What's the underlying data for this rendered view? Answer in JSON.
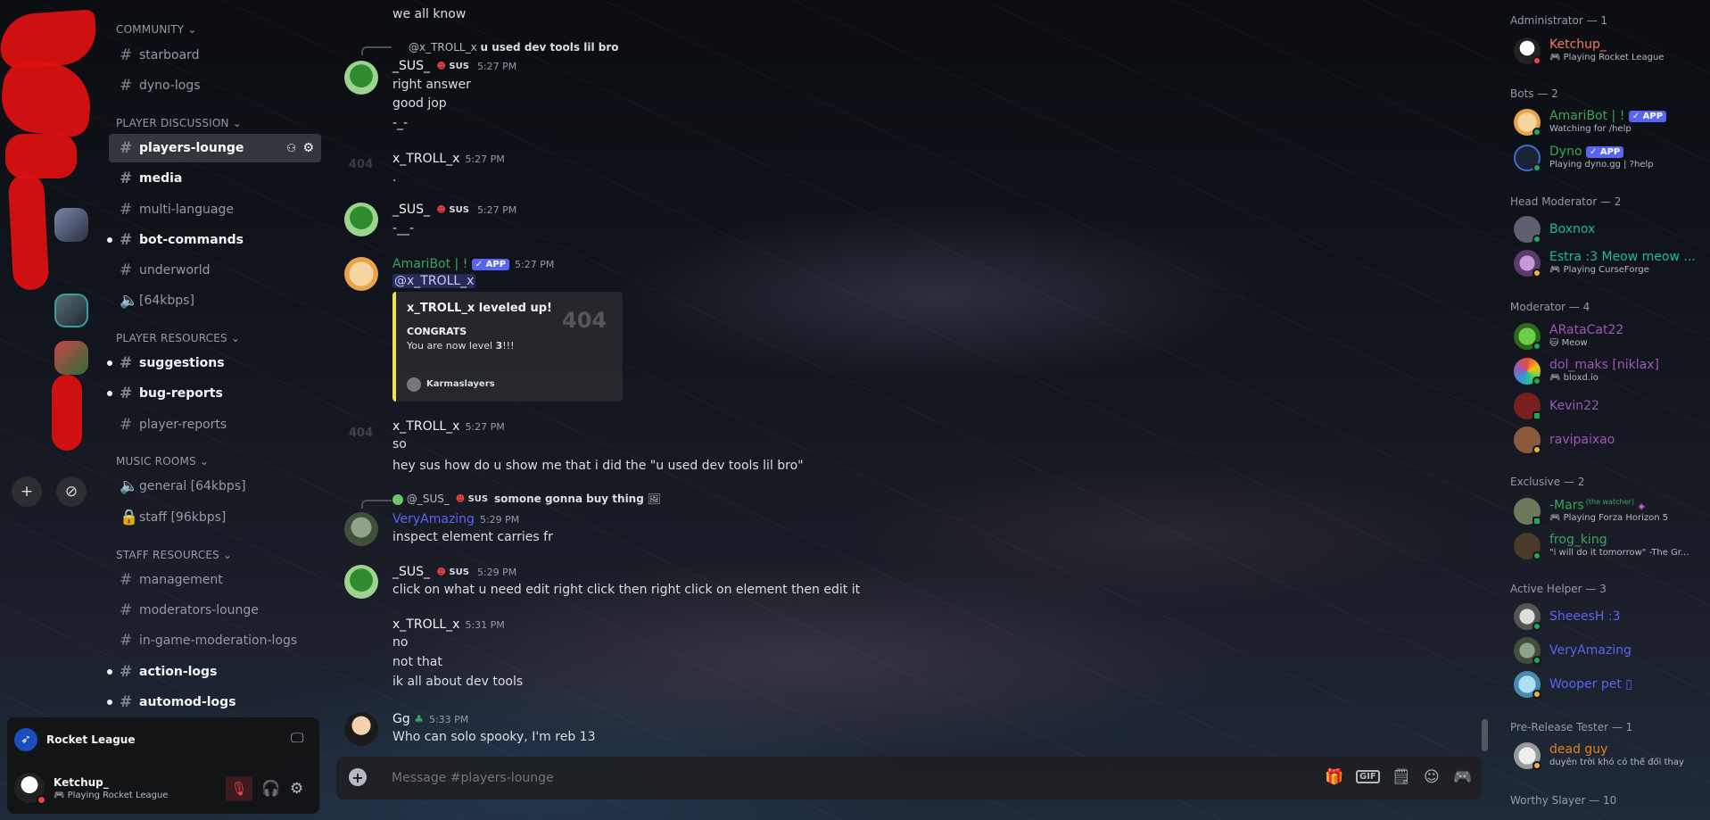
{
  "categories": {
    "community": "COMMUNITY",
    "player_discussion": "PLAYER DISCUSSION",
    "player_resources": "PLAYER RESOURCES",
    "music_rooms": "MUSIC ROOMS",
    "staff_resources": "STAFF RESOURCES"
  },
  "channels": {
    "starboard": "starboard",
    "dyno_logs": "dyno-logs",
    "players_lounge": "players-lounge",
    "media": "media",
    "multi_language": "multi-language",
    "bot_commands": "bot-commands",
    "underworld": "underworld",
    "voice_64": "[64kbps]",
    "suggestions": "suggestions",
    "bug_reports": "bug-reports",
    "player_reports": "player-reports",
    "general": "general [64kbps]",
    "staff": "staff [96kbps]",
    "management": "management",
    "moderators_lounge": "moderators-lounge",
    "ingame_logs": "in-game-moderation-logs",
    "action_logs": "action-logs",
    "automod_logs": "automod-logs"
  },
  "panel": {
    "activity_title": "Rocket League",
    "username": "Ketchup_",
    "status": "Playing Rocket League"
  },
  "messages": {
    "m0": {
      "line": "we all know"
    },
    "m1": {
      "reply_user": "@x_TROLL_x",
      "reply_text": "u used dev tools lil bro",
      "user": "_SUS_",
      "tag": "SUS",
      "time": "5:27 PM",
      "l1": "right answer",
      "l2": "good jop",
      "l3": "-_-"
    },
    "m2": {
      "user": "x_TROLL_x",
      "time": "5:27 PM",
      "l1": "."
    },
    "m3": {
      "user": "_SUS_",
      "tag": "SUS",
      "time": "5:27 PM",
      "l1": "-__-"
    },
    "m4": {
      "user": "AmariBot | !",
      "app": "✓ APP",
      "time": "5:27 PM",
      "mention": "@x_TROLL_x",
      "embed_title": "x_TROLL_x leveled up!",
      "embed_sub": "CONGRATS",
      "embed_text": "You are now level",
      "embed_level": "3",
      "embed_bang": "!!!",
      "embed_footer": "Karmaslayers",
      "embed_img": "404"
    },
    "m5": {
      "user": "x_TROLL_x",
      "time": "5:27 PM",
      "l1": "so",
      "l2": "hey sus how do u show me that i did the \"u used dev tools lil bro\""
    },
    "m6": {
      "reply_user": "@_SUS_",
      "reply_tag": "SUS",
      "reply_text": "somone gonna buy thing",
      "user": "VeryAmazing",
      "time": "5:29 PM",
      "l1": "inspect element carries fr"
    },
    "m7": {
      "user": "_SUS_",
      "tag": "SUS",
      "time": "5:29 PM",
      "l1": "click on what u need edit right click then right click on element then edit it"
    },
    "m8": {
      "user": "x_TROLL_x",
      "time": "5:31 PM",
      "l1": "no",
      "l2": "not that",
      "l3": "ik all about dev tools"
    },
    "m9": {
      "user": "Gg",
      "time": "5:33 PM",
      "l1": "Who can solo spooky, I'm reb 13"
    }
  },
  "faint404": "404",
  "composer": {
    "placeholder": "Message #players-lounge"
  },
  "members": {
    "administrator": "Administrator — 1",
    "bots": "Bots — 2",
    "head_moderator": "Head Moderator — 2",
    "moderator": "Moderator — 4",
    "exclusive": "Exclusive — 2",
    "active_helper": "Active Helper — 3",
    "prerelease": "Pre-Release Tester — 1",
    "worthy": "Worthy Slayer — 10",
    "ketchup": {
      "name": "Ketchup_",
      "status": "Playing Rocket League"
    },
    "amari": {
      "name": "AmariBot | !",
      "app": "✓ APP",
      "status": "Watching for /help"
    },
    "dyno": {
      "name": "Dyno",
      "app": "✓ APP",
      "status": "Playing dyno.gg | ?help"
    },
    "boxnox": {
      "name": "Boxnox"
    },
    "estra": {
      "name": "Estra :3 Meow meow ...",
      "status": "Playing CurseForge"
    },
    "aratacat": {
      "name": "ARataCat22",
      "status": "Meow"
    },
    "dolmaks": {
      "name": "dol_maks [niklax]",
      "status": "bloxd.io"
    },
    "kevin": {
      "name": "Kevin22"
    },
    "ravi": {
      "name": "ravipaixao"
    },
    "mars": {
      "name": "-Mars",
      "sup": "(the watcher)",
      "status": "Playing Forza Horizon 5"
    },
    "frog": {
      "name": "frog_king",
      "status": "\"i will do it tomorrow\" -The Gr..."
    },
    "sheeesh": {
      "name": "SheeesH :3"
    },
    "veryamazing": {
      "name": "VeryAmazing"
    },
    "wooper": {
      "name": "Wooper pet ▯"
    },
    "dead": {
      "name": "dead guy",
      "status": "duyên trời khó có thể đổi thay"
    }
  },
  "colors": {
    "accent": "#5865f2",
    "online": "#23a55a",
    "idle": "#f0b232",
    "dnd": "#f23f43",
    "admin": "#f47b67",
    "bot": "#3ba55d",
    "headmod": "#1abc9c",
    "mod": "#9b59b6",
    "helper": "#5865f2",
    "tester": "#e67e22"
  }
}
